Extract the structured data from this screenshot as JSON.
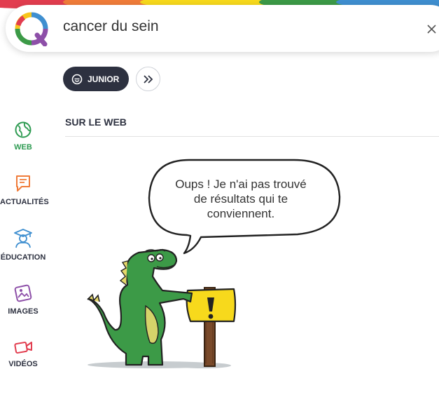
{
  "search": {
    "query": "cancer du sein",
    "clear_icon": "close-icon"
  },
  "filters": {
    "junior_label": "JUNIOR",
    "more_icon": "double-chevron-right-icon"
  },
  "sidebar": {
    "items": [
      {
        "label": "WEB",
        "icon": "globe-icon",
        "active": true
      },
      {
        "label": "ACTUALITÉS",
        "icon": "news-bubble-icon",
        "active": false
      },
      {
        "label": "ÉDUCATION",
        "icon": "graduate-icon",
        "active": false
      },
      {
        "label": "IMAGES",
        "icon": "image-icon",
        "active": false
      },
      {
        "label": "VIDÉOS",
        "icon": "video-camera-icon",
        "active": false
      }
    ]
  },
  "main": {
    "section_title": "SUR LE WEB",
    "empty_state": {
      "line1": "Oups ! Je n'ai pas trouvé",
      "line2": "de résultats qui te",
      "line3": "conviennent."
    }
  },
  "colors": {
    "brand_green": "#2e9b52",
    "nav_dark": "#2d3140",
    "actualites": "#f07c3a",
    "education": "#3f8fd0",
    "images": "#8d4fa8",
    "videos": "#e23d4f",
    "dino_green": "#3c9a47",
    "sign_yellow": "#f7d91c"
  }
}
